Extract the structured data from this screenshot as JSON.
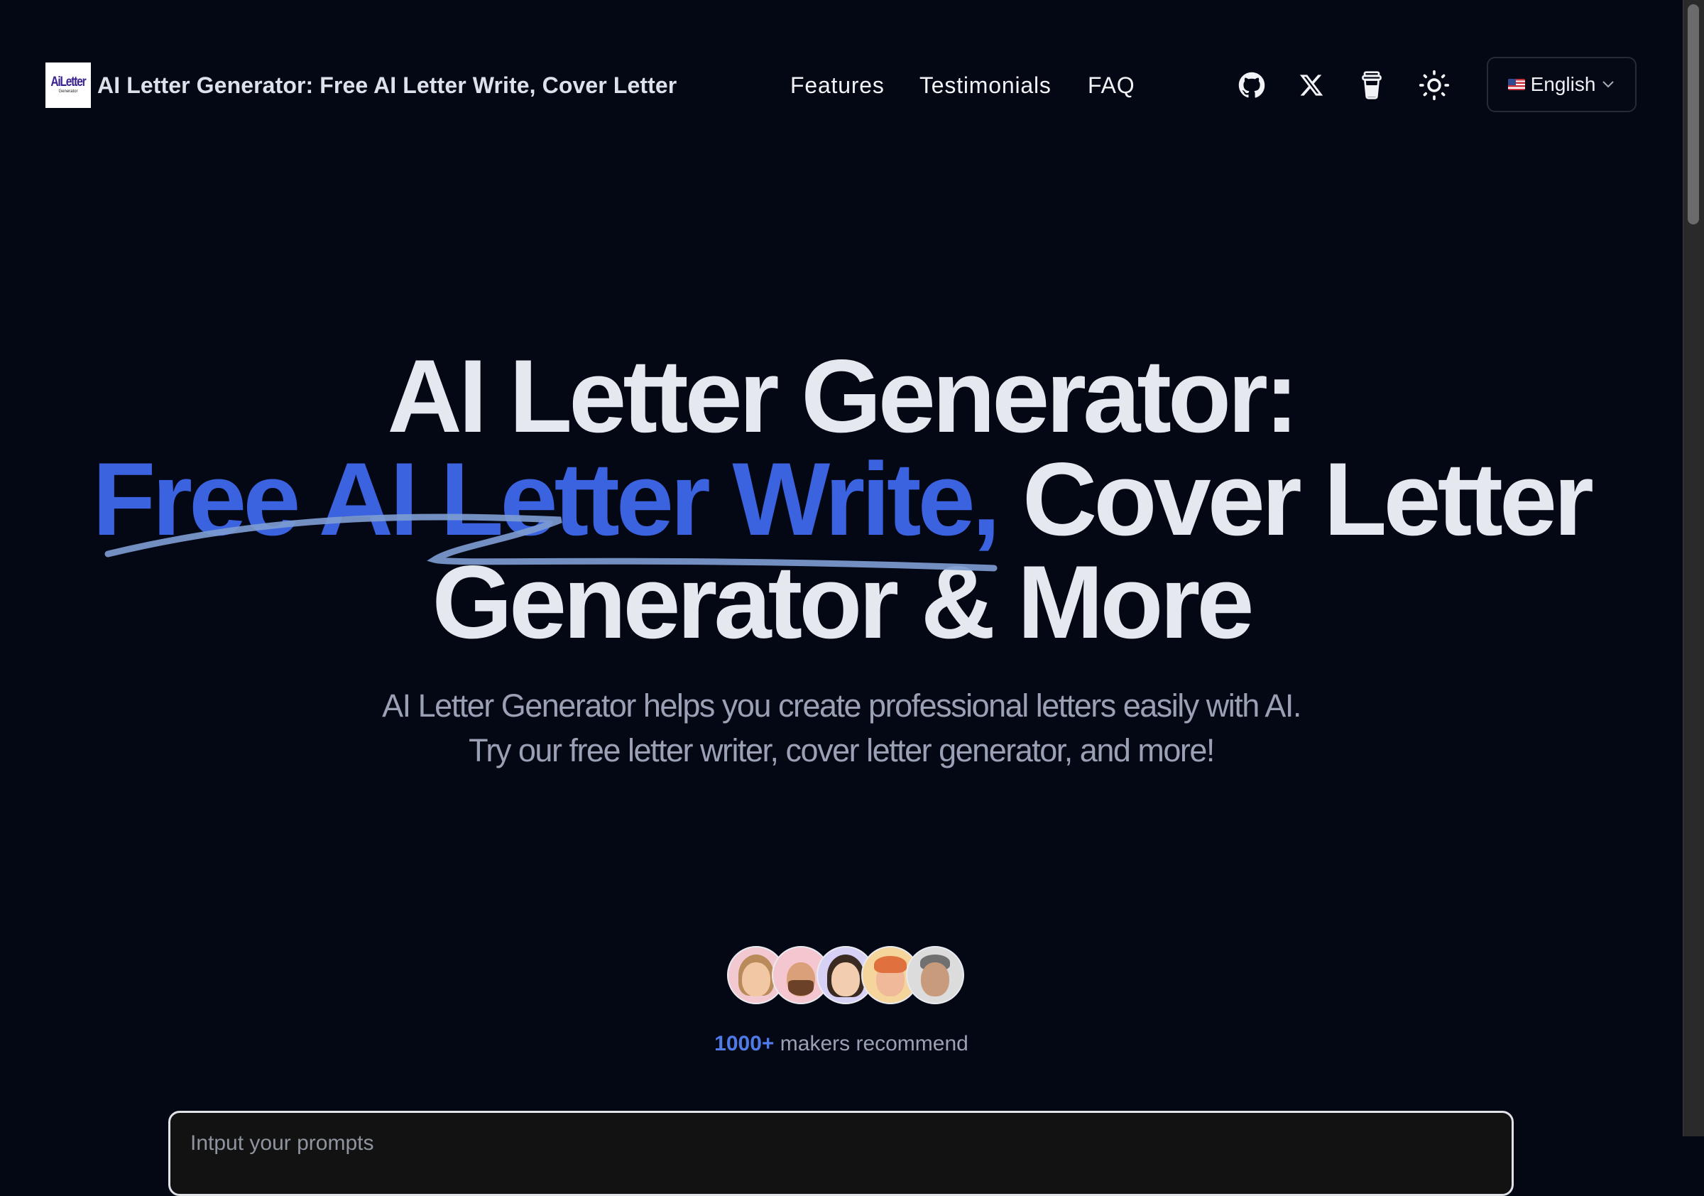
{
  "header": {
    "logo": {
      "line1": "AiLetter",
      "line2": "Generator"
    },
    "brand_title": "AI Letter Generator: Free AI Letter Write, Cover Letter",
    "nav": [
      {
        "label": "Features"
      },
      {
        "label": "Testimonials"
      },
      {
        "label": "FAQ"
      }
    ],
    "icons": [
      "github-icon",
      "x-twitter-icon",
      "coffee-cup-icon",
      "sun-theme-icon"
    ],
    "language": {
      "flag": "us-flag-icon",
      "label": "English"
    }
  },
  "hero": {
    "line1": "AI Letter Generator:",
    "line2_accent": "Free AI Letter Write,",
    "line2_rest": "Cover Letter",
    "line3": "Generator & More",
    "subtitle_line1": "AI Letter Generator helps you create professional letters easily with AI.",
    "subtitle_line2": "Try our free letter writer, cover letter generator, and more!",
    "accent_color": "#3b63e0"
  },
  "social_proof": {
    "avatars": [
      {
        "name": "avatar-1",
        "bg": "#f3c9d1"
      },
      {
        "name": "avatar-2",
        "bg": "#f4c6d0"
      },
      {
        "name": "avatar-3",
        "bg": "#d7d2f5"
      },
      {
        "name": "avatar-4",
        "bg": "#f6d59c"
      },
      {
        "name": "avatar-5",
        "bg": "#dcdcdc"
      }
    ],
    "count": "1000+",
    "text": "makers recommend"
  },
  "prompt": {
    "placeholder": "Intput your prompts",
    "value": ""
  }
}
